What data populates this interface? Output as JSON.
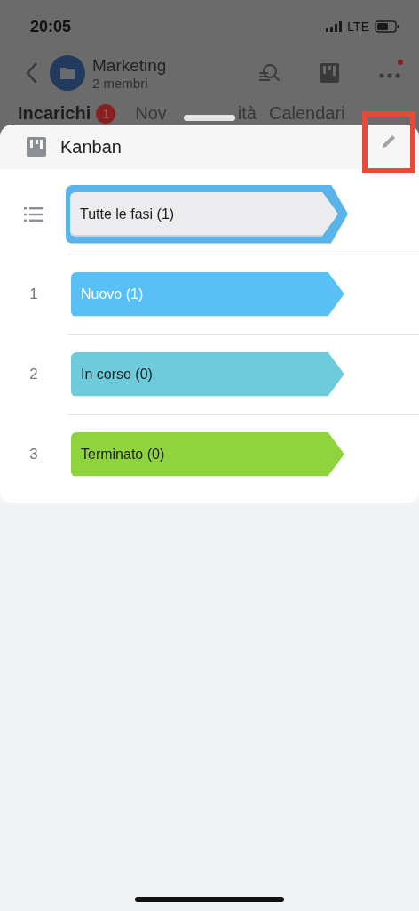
{
  "status_bar": {
    "time": "20:05",
    "network": "LTE"
  },
  "header": {
    "title": "Marketing",
    "subtitle": "2 membri",
    "notification_dot": true
  },
  "tabs": [
    {
      "label": "Incarichi",
      "badge": "1",
      "selected": true
    },
    {
      "label": "Nov",
      "selected": false
    },
    {
      "label": "ità",
      "selected": false
    },
    {
      "label": "Calendari",
      "selected": false
    }
  ],
  "sheet": {
    "title": "Kanban",
    "edit_highlighted": true,
    "stages": [
      {
        "kind": "all",
        "label": "Tutte le fasi (1)",
        "color": "#ececee",
        "selected": true
      },
      {
        "kind": "stage",
        "number": "1",
        "label": "Nuovo (1)",
        "color": "#58c0f5",
        "selected": false
      },
      {
        "kind": "stage",
        "number": "2",
        "label": "In corso (0)",
        "color": "#6ecbdc",
        "selected": false
      },
      {
        "kind": "stage",
        "number": "3",
        "label": "Terminato (0)",
        "color": "#8fd43f",
        "selected": false
      }
    ]
  }
}
